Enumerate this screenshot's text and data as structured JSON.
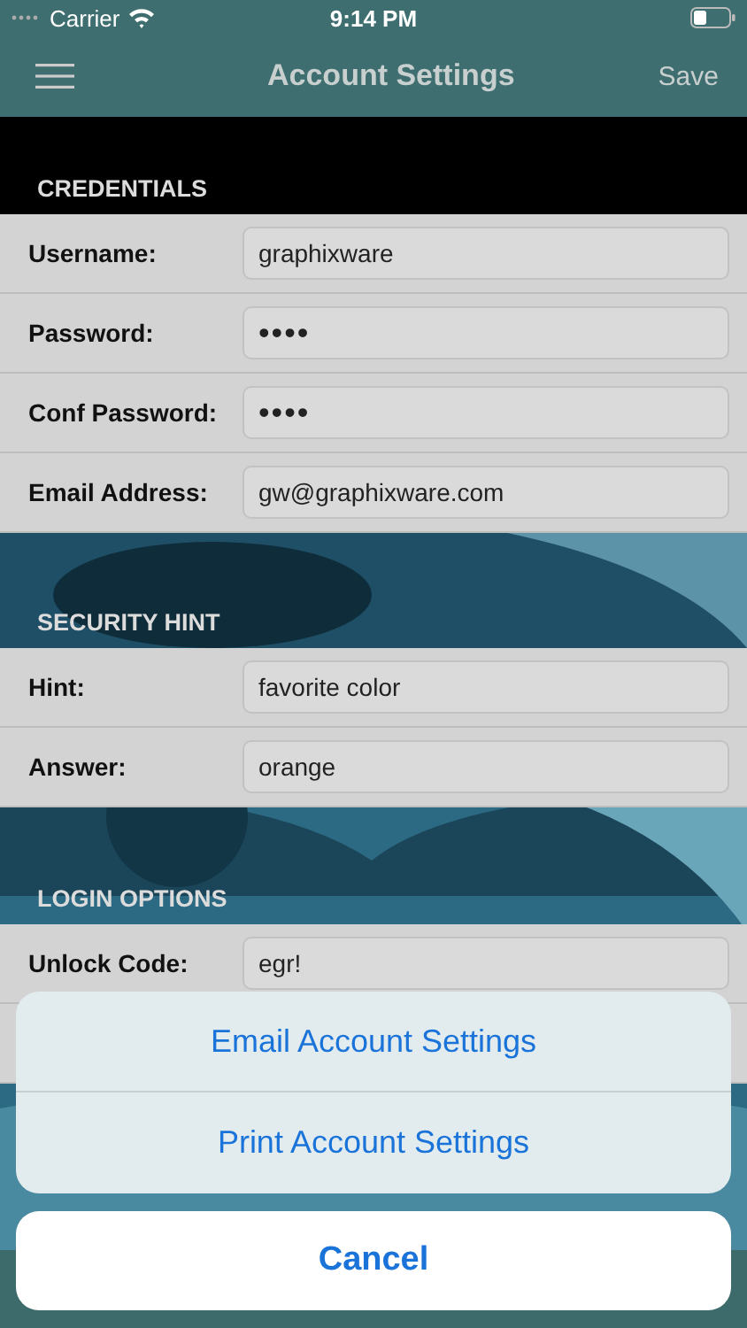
{
  "status_bar": {
    "carrier": "Carrier",
    "time": "9:14 PM"
  },
  "nav_bar": {
    "title": "Account Settings",
    "action": "Save"
  },
  "sections": [
    {
      "title": "CREDENTIALS",
      "rows": [
        {
          "kind": "text",
          "label": "Username:",
          "value": "graphixware"
        },
        {
          "kind": "password",
          "label": "Password:",
          "value": "••••"
        },
        {
          "kind": "password",
          "label": "Conf Password:",
          "value": "••••"
        },
        {
          "kind": "text",
          "label": "Email Address:",
          "value": "gw@graphixware.com"
        }
      ]
    },
    {
      "title": "SECURITY HINT",
      "rows": [
        {
          "kind": "text",
          "label": "Hint:",
          "value": "favorite color"
        },
        {
          "kind": "text",
          "label": "Answer:",
          "value": "orange"
        }
      ]
    },
    {
      "title": "LOGIN OPTIONS",
      "rows": [
        {
          "kind": "text",
          "label": "Unlock Code:",
          "value": "egr!"
        }
      ]
    }
  ],
  "action_sheet": {
    "actions": [
      "Email Account Settings",
      "Print Account Settings"
    ],
    "cancel": "Cancel"
  }
}
